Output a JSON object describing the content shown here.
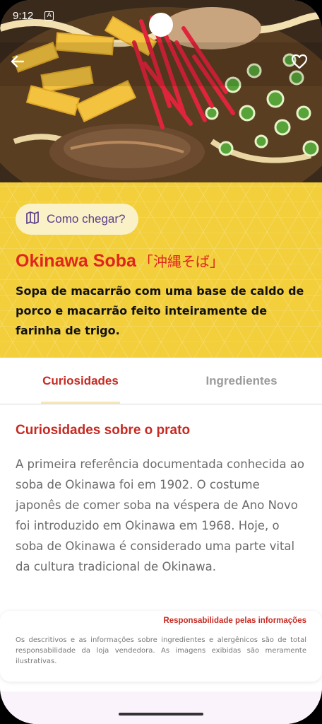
{
  "status_bar": {
    "time": "9:12",
    "icons": [
      "shield-icon",
      "app-notification-icon"
    ]
  },
  "header": {
    "back_icon": "arrow-left-icon",
    "favorite_icon": "heart-outline-icon"
  },
  "directions": {
    "icon": "map-icon",
    "label": "Como chegar?"
  },
  "dish": {
    "name": "Okinawa Soba",
    "name_jp": "「沖縄そば」",
    "description": "Sopa de macarrão com uma base de caldo de porco e macarrão feito inteiramente de farinha de trigo."
  },
  "tabs": [
    {
      "label": "Curiosidades",
      "selected": true
    },
    {
      "label": "Ingredientes",
      "selected": false
    }
  ],
  "section": {
    "title": "Curiosidades sobre o prato",
    "body": "A primeira referência documentada conhecida ao soba de Okinawa foi em 1902. O costume japonês de comer soba na véspera de Ano Novo foi introduzido em Okinawa em 1968. Hoje, o soba de Okinawa é considerado uma parte vital da cultura tradicional de Okinawa."
  },
  "disclaimer": {
    "title": "Responsabilidade pelas informações",
    "text": "Os descritivos e as informações sobre ingredientes e alergênicos são de total responsabilidade da loja vendedora. As imagens exibidas são meramente ilustrativas."
  },
  "colors": {
    "accent_red": "#c62a22",
    "title_red": "#e0261c",
    "panel_yellow": "#f3cf3c",
    "chip_text": "#5b3f8a"
  }
}
